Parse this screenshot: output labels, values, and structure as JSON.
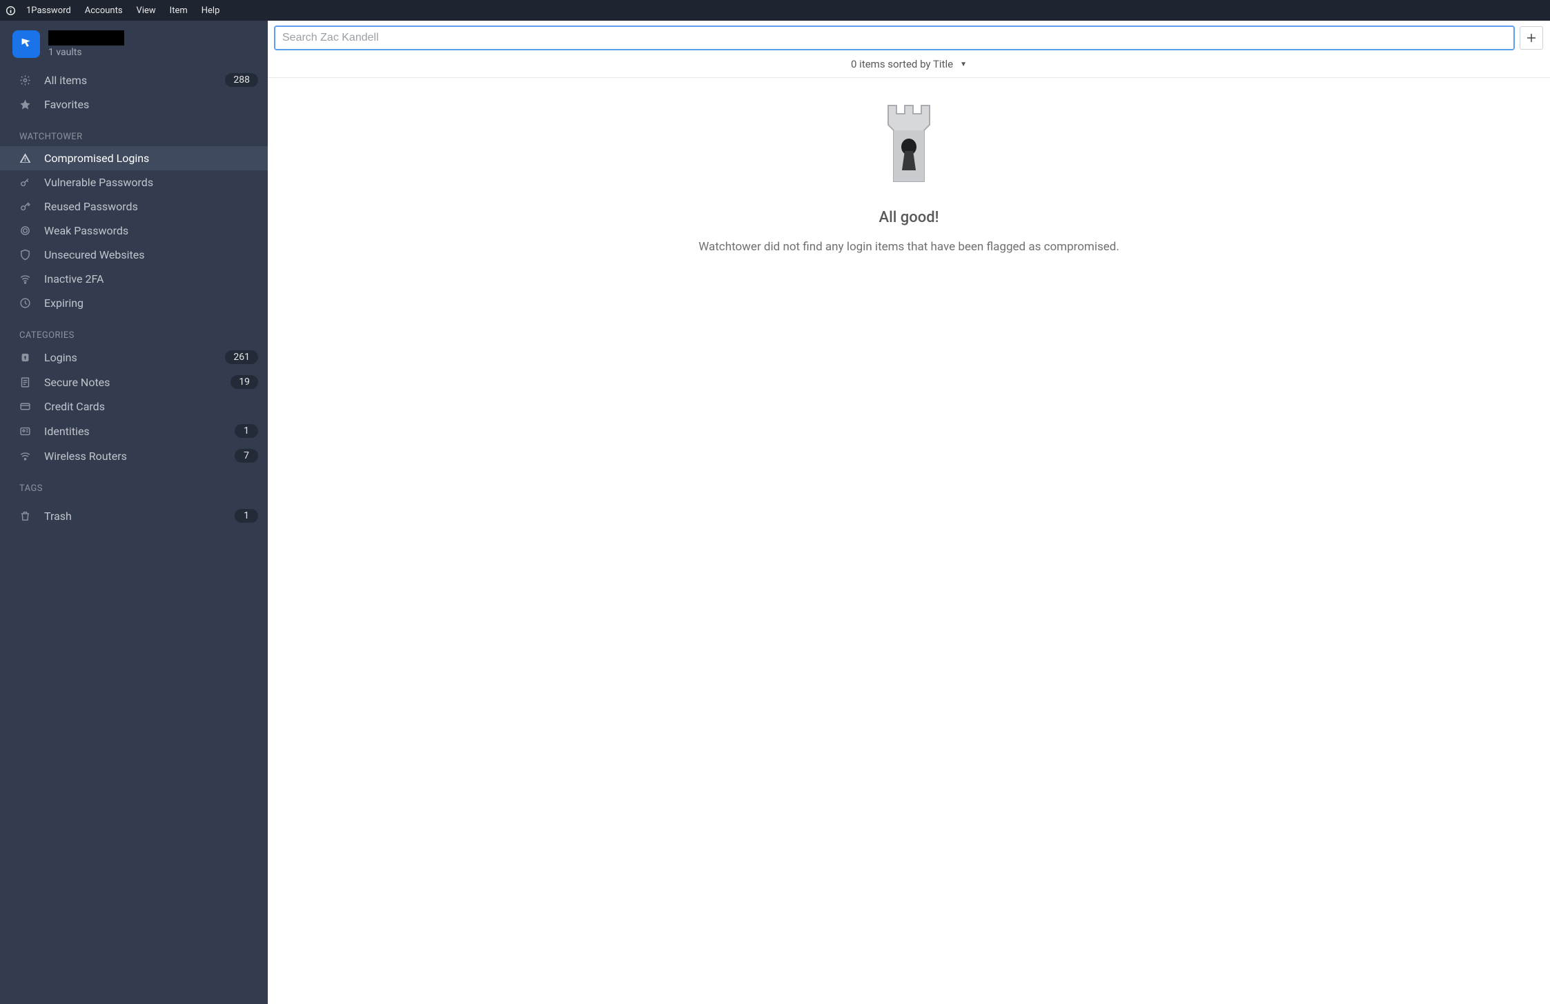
{
  "menubar": {
    "items": [
      "1Password",
      "Accounts",
      "View",
      "Item",
      "Help"
    ]
  },
  "account": {
    "vaults_label": "1 vaults"
  },
  "sidebar": {
    "top": [
      {
        "icon": "settings-icon",
        "label": "All items",
        "badge": "288"
      },
      {
        "icon": "star-icon",
        "label": "Favorites",
        "badge": null
      }
    ],
    "watchtower": {
      "heading": "WATCHTOWER",
      "items": [
        {
          "icon": "alert-icon",
          "label": "Compromised Logins",
          "badge": null,
          "active": true
        },
        {
          "icon": "vuln-icon",
          "label": "Vulnerable Passwords",
          "badge": null
        },
        {
          "icon": "key-icon",
          "label": "Reused Passwords",
          "badge": null
        },
        {
          "icon": "circle-icon",
          "label": "Weak Passwords",
          "badge": null
        },
        {
          "icon": "shield-icon",
          "label": "Unsecured Websites",
          "badge": null
        },
        {
          "icon": "wifi-icon",
          "label": "Inactive 2FA",
          "badge": null
        },
        {
          "icon": "clock-icon",
          "label": "Expiring",
          "badge": null
        }
      ]
    },
    "categories": {
      "heading": "CATEGORIES",
      "items": [
        {
          "icon": "lock-icon",
          "label": "Logins",
          "badge": "261"
        },
        {
          "icon": "note-icon",
          "label": "Secure Notes",
          "badge": "19"
        },
        {
          "icon": "card-icon",
          "label": "Credit Cards",
          "badge": null
        },
        {
          "icon": "id-icon",
          "label": "Identities",
          "badge": "1"
        },
        {
          "icon": "router-icon",
          "label": "Wireless Routers",
          "badge": "7"
        }
      ]
    },
    "tags": {
      "heading": "TAGS",
      "items": []
    },
    "trash": {
      "icon": "trash-icon",
      "label": "Trash",
      "badge": "1"
    }
  },
  "main": {
    "search_placeholder": "Search Zac Kandell",
    "sort_label": "0 items sorted by Title",
    "empty_title": "All good!",
    "empty_desc": "Watchtower did not find any login items that have been flagged as compromised."
  }
}
